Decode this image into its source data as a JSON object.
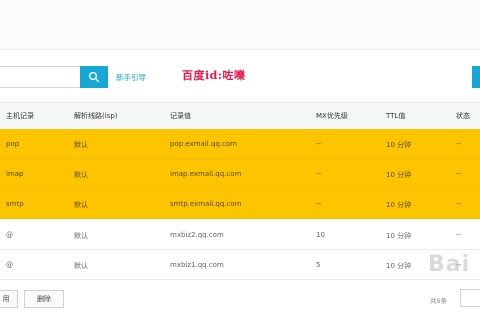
{
  "toolbar": {
    "search_value": "",
    "search_icon": "search-icon",
    "guide_link": "新手引导",
    "watermark_id": "百度id:咗嚛"
  },
  "table": {
    "columns": [
      "主机记录",
      "解析线路(isp)",
      "记录值",
      "MX优先级",
      "TTL值",
      "状态"
    ],
    "rows": [
      {
        "host": "pop",
        "line": "默认",
        "value": "pop.exmail.qq.com",
        "mx": "--",
        "ttl": "10 分钟",
        "status": "--",
        "selected": true
      },
      {
        "host": "imap",
        "line": "默认",
        "value": "imap.exmail.qq.com",
        "mx": "--",
        "ttl": "10 分钟",
        "status": "--",
        "selected": true
      },
      {
        "host": "smtp",
        "line": "默认",
        "value": "smtp.exmail.qq.com",
        "mx": "--",
        "ttl": "10 分钟",
        "status": "--",
        "selected": true
      },
      {
        "host": "@",
        "line": "默认",
        "value": "mxbiz2.qq.com",
        "mx": "10",
        "ttl": "10 分钟",
        "status": "--",
        "selected": false
      },
      {
        "host": "@",
        "line": "默认",
        "value": "mxbiz1.qq.com",
        "mx": "5",
        "ttl": "10 分钟",
        "status": "--",
        "selected": false
      }
    ]
  },
  "footer": {
    "button_1": "用",
    "button_2": "删除",
    "total_text": "共5条"
  },
  "watermark": {
    "logo_text": "Bai"
  },
  "colors": {
    "accent": "#16a8d4",
    "selected_row": "#fdc400",
    "watermark_red": "#e8194a"
  }
}
